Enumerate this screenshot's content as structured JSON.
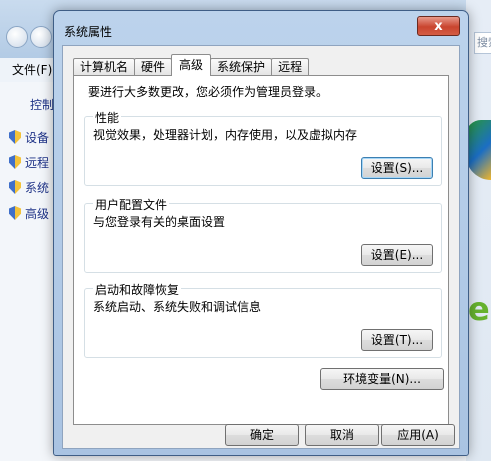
{
  "background": {
    "menu_file": "文件(F)",
    "control_panel_label": "控制",
    "left_items": [
      "设备",
      "远程",
      "系统",
      "高级"
    ],
    "search_placeholder": "搜索"
  },
  "dialog": {
    "title": "系统属性",
    "close_glyph": "x",
    "tabs": [
      "计算机名",
      "硬件",
      "高级",
      "系统保护",
      "远程"
    ],
    "active_tab": "高级",
    "intro": "要进行大多数更改，您必须作为管理员登录。",
    "groups": [
      {
        "title": "性能",
        "desc": "视觉效果，处理器计划，内存使用，以及虚拟内存",
        "button": "设置(S)..."
      },
      {
        "title": "用户配置文件",
        "desc": "与您登录有关的桌面设置",
        "button": "设置(E)..."
      },
      {
        "title": "启动和故障恢复",
        "desc": "系统启动、系统失败和调试信息",
        "button": "设置(T)..."
      }
    ],
    "env_button": "环境变量(N)...",
    "ok_button": "确定",
    "cancel_button": "取消",
    "apply_button": "应用(A)"
  },
  "colors": {
    "accent_link": "#1e3287",
    "close_button": "#c9452f"
  }
}
